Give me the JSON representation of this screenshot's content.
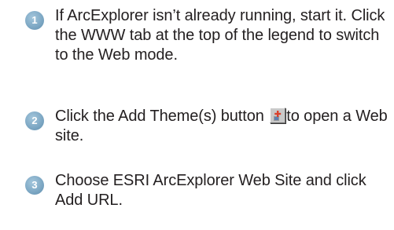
{
  "steps": [
    {
      "number": "1",
      "text": "If ArcExplorer isn’t already running, start it. Click the WWW tab at the top of the legend to switch to the Web mode."
    },
    {
      "number": "2",
      "text_before": "Click the Add Theme(s) button",
      "text_after": "to open a Web site.",
      "button_icon": "add-theme-icon"
    },
    {
      "number": "3",
      "text": "Choose ESRI ArcExplorer Web Site and click Add URL."
    }
  ],
  "colors": {
    "badge": "#7fa9c5",
    "text": "#231f20"
  }
}
